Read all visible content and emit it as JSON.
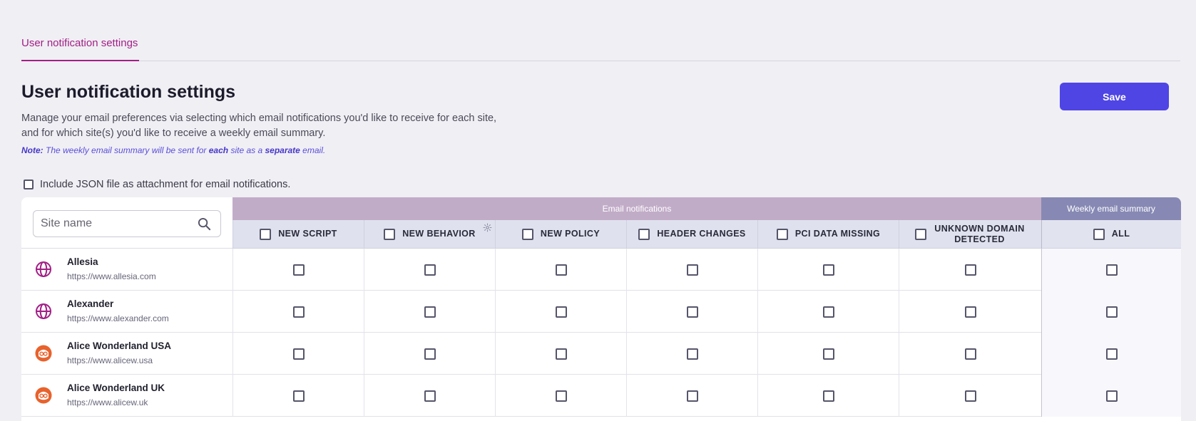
{
  "tabs": [
    {
      "label": "User notification settings",
      "active": true
    }
  ],
  "page": {
    "title": "User notification settings",
    "description_line1": "Manage your email preferences via selecting which email notifications you'd like to receive for each site,",
    "description_line2": "and for which site(s) you'd like to receive a weekly email summary.",
    "note": {
      "label": "Note:",
      "text1": " The weekly email summary will be sent for ",
      "bold1": "each",
      "text2": " site as a ",
      "bold2": "separate",
      "text3": " email."
    },
    "save_label": "Save",
    "json_option_label": "Include JSON file as attachment for email notifications."
  },
  "table": {
    "search_placeholder": "Site name",
    "group_email": "Email notifications",
    "group_weekly": "Weekly email summary",
    "columns": [
      "NEW SCRIPT",
      "NEW BEHAVIOR",
      "NEW POLICY",
      "HEADER CHANGES",
      "PCI DATA MISSING",
      "UNKNOWN DOMAIN DETECTED"
    ],
    "weekly_column": "ALL",
    "rows": [
      {
        "name": "Allesia",
        "url": "https://www.allesia.com",
        "icon": "globe-icon"
      },
      {
        "name": "Alexander",
        "url": "https://www.alexander.com",
        "icon": "globe-icon"
      },
      {
        "name": "Alice Wonderland USA",
        "url": "https://www.alicew.usa",
        "icon": "alice-avatar-icon"
      },
      {
        "name": "Alice Wonderland UK",
        "url": "https://www.alicew.uk",
        "icon": "alice-avatar-icon"
      }
    ]
  },
  "colors": {
    "accent": "#a21f86",
    "primary_button": "#4f45e4",
    "email_group": "#c1acc8",
    "weekly_group": "#8789b4",
    "site_icon_orange": "#e8622c"
  }
}
